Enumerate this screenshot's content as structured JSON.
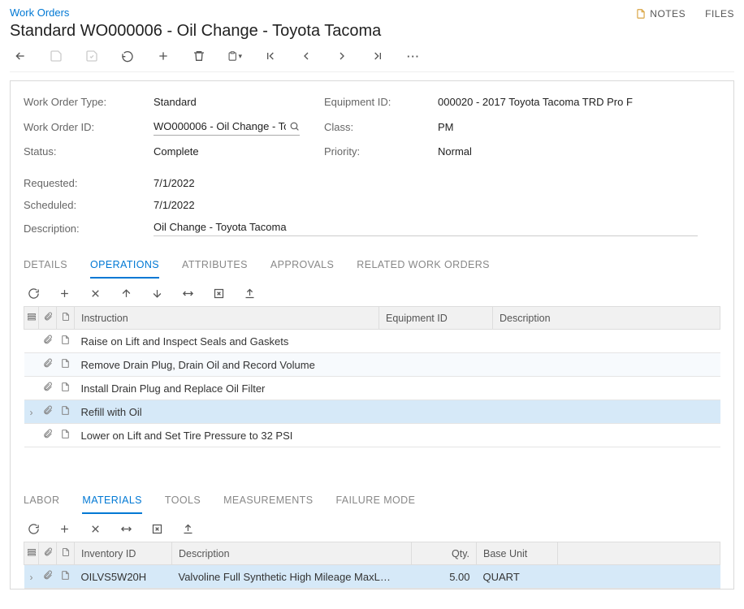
{
  "header": {
    "breadcrumb": "Work Orders",
    "title": "Standard WO000006 - Oil Change - Toyota Tacoma",
    "actions": {
      "notes": "NOTES",
      "files": "FILES"
    }
  },
  "form": {
    "labels": {
      "type": "Work Order Type:",
      "id": "Work Order ID:",
      "status": "Status:",
      "equipment": "Equipment ID:",
      "class": "Class:",
      "priority": "Priority:",
      "requested": "Requested:",
      "scheduled": "Scheduled:",
      "description": "Description:"
    },
    "values": {
      "type": "Standard",
      "id": "WO000006 - Oil Change - To",
      "status": "Complete",
      "equipment": "000020 - 2017 Toyota Tacoma TRD Pro F",
      "class": "PM",
      "priority": "Normal",
      "requested": "7/1/2022",
      "scheduled": "7/1/2022",
      "description": "Oil Change - Toyota Tacoma"
    }
  },
  "tabs_main": {
    "details": "DETAILS",
    "operations": "OPERATIONS",
    "attributes": "ATTRIBUTES",
    "approvals": "APPROVALS",
    "related": "RELATED WORK ORDERS"
  },
  "operations": {
    "columns": {
      "instruction": "Instruction",
      "equipment": "Equipment ID",
      "description": "Description"
    },
    "rows": [
      {
        "instruction": "Raise on Lift and Inspect Seals and Gaskets",
        "selected": false
      },
      {
        "instruction": "Remove Drain Plug, Drain Oil and Record Volume",
        "selected": false,
        "alt": true
      },
      {
        "instruction": "Install Drain Plug and Replace Oil Filter",
        "selected": false
      },
      {
        "instruction": "Refill with Oil",
        "selected": true
      },
      {
        "instruction": "Lower on Lift and Set Tire Pressure to 32 PSI",
        "selected": false
      }
    ]
  },
  "tabs_sub": {
    "labor": "LABOR",
    "materials": "MATERIALS",
    "tools": "TOOLS",
    "measurements": "MEASUREMENTS",
    "failure": "FAILURE MODE"
  },
  "materials": {
    "columns": {
      "inventory": "Inventory ID",
      "description": "Description",
      "qty": "Qty.",
      "unit": "Base Unit"
    },
    "rows": [
      {
        "inventory": "OILVS5W20H",
        "description": "Valvoline Full Synthetic High Mileage MaxL…",
        "qty": "5.00",
        "unit": "QUART"
      }
    ]
  }
}
